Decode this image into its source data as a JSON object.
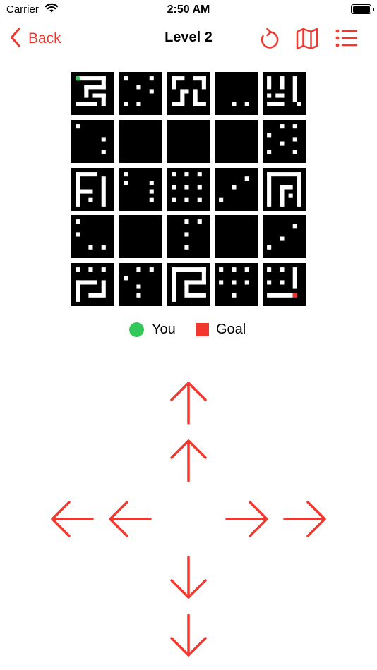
{
  "status_bar": {
    "carrier": "Carrier",
    "time": "2:50 AM"
  },
  "nav": {
    "back_label": "Back",
    "title": "Level 2"
  },
  "legend": {
    "you_label": "You",
    "goal_label": "Goal"
  },
  "colors": {
    "accent": "#F2382E",
    "player": "#34C759",
    "goal": "#F2382E",
    "cell_bg": "#000000",
    "wall": "#FFFFFF"
  },
  "icons": [
    "chevron-left-icon",
    "restart-icon",
    "map-icon",
    "list-icon",
    "arrow-up-icon",
    "arrow-down-icon",
    "arrow-left-icon",
    "arrow-right-icon"
  ],
  "board": {
    "rows": 5,
    "cols": 5,
    "cells": [
      {
        "r": 0,
        "c": 0,
        "label": "cell-r1-c1"
      },
      {
        "r": 0,
        "c": 1,
        "label": "cell-r1-c2"
      },
      {
        "r": 0,
        "c": 2,
        "label": "cell-r1-c3"
      },
      {
        "r": 0,
        "c": 3,
        "label": "cell-r1-c4"
      },
      {
        "r": 0,
        "c": 4,
        "label": "cell-r1-c5"
      },
      {
        "r": 1,
        "c": 0,
        "label": "cell-r2-c1"
      },
      {
        "r": 1,
        "c": 1,
        "label": "cell-r2-c2"
      },
      {
        "r": 1,
        "c": 2,
        "label": "cell-r2-c3"
      },
      {
        "r": 1,
        "c": 3,
        "label": "cell-r2-c4"
      },
      {
        "r": 1,
        "c": 4,
        "label": "cell-r2-c5"
      },
      {
        "r": 2,
        "c": 0,
        "label": "cell-r3-c1"
      },
      {
        "r": 2,
        "c": 1,
        "label": "cell-r3-c2"
      },
      {
        "r": 2,
        "c": 2,
        "label": "cell-r3-c3"
      },
      {
        "r": 2,
        "c": 3,
        "label": "cell-r3-c4"
      },
      {
        "r": 2,
        "c": 4,
        "label": "cell-r3-c5"
      },
      {
        "r": 3,
        "c": 0,
        "label": "cell-r4-c1"
      },
      {
        "r": 3,
        "c": 1,
        "label": "cell-r4-c2"
      },
      {
        "r": 3,
        "c": 2,
        "label": "cell-r4-c3"
      },
      {
        "r": 3,
        "c": 3,
        "label": "cell-r4-c4"
      },
      {
        "r": 3,
        "c": 4,
        "label": "cell-r4-c5"
      },
      {
        "r": 4,
        "c": 0,
        "label": "cell-r5-c1"
      },
      {
        "r": 4,
        "c": 1,
        "label": "cell-r5-c2"
      },
      {
        "r": 4,
        "c": 2,
        "label": "cell-r5-c3"
      },
      {
        "r": 4,
        "c": 3,
        "label": "cell-r5-c4"
      },
      {
        "r": 4,
        "c": 4,
        "label": "cell-r5-c5"
      }
    ],
    "player": {
      "r": 0,
      "c": 0
    },
    "goal": {
      "r": 4,
      "c": 4
    }
  }
}
